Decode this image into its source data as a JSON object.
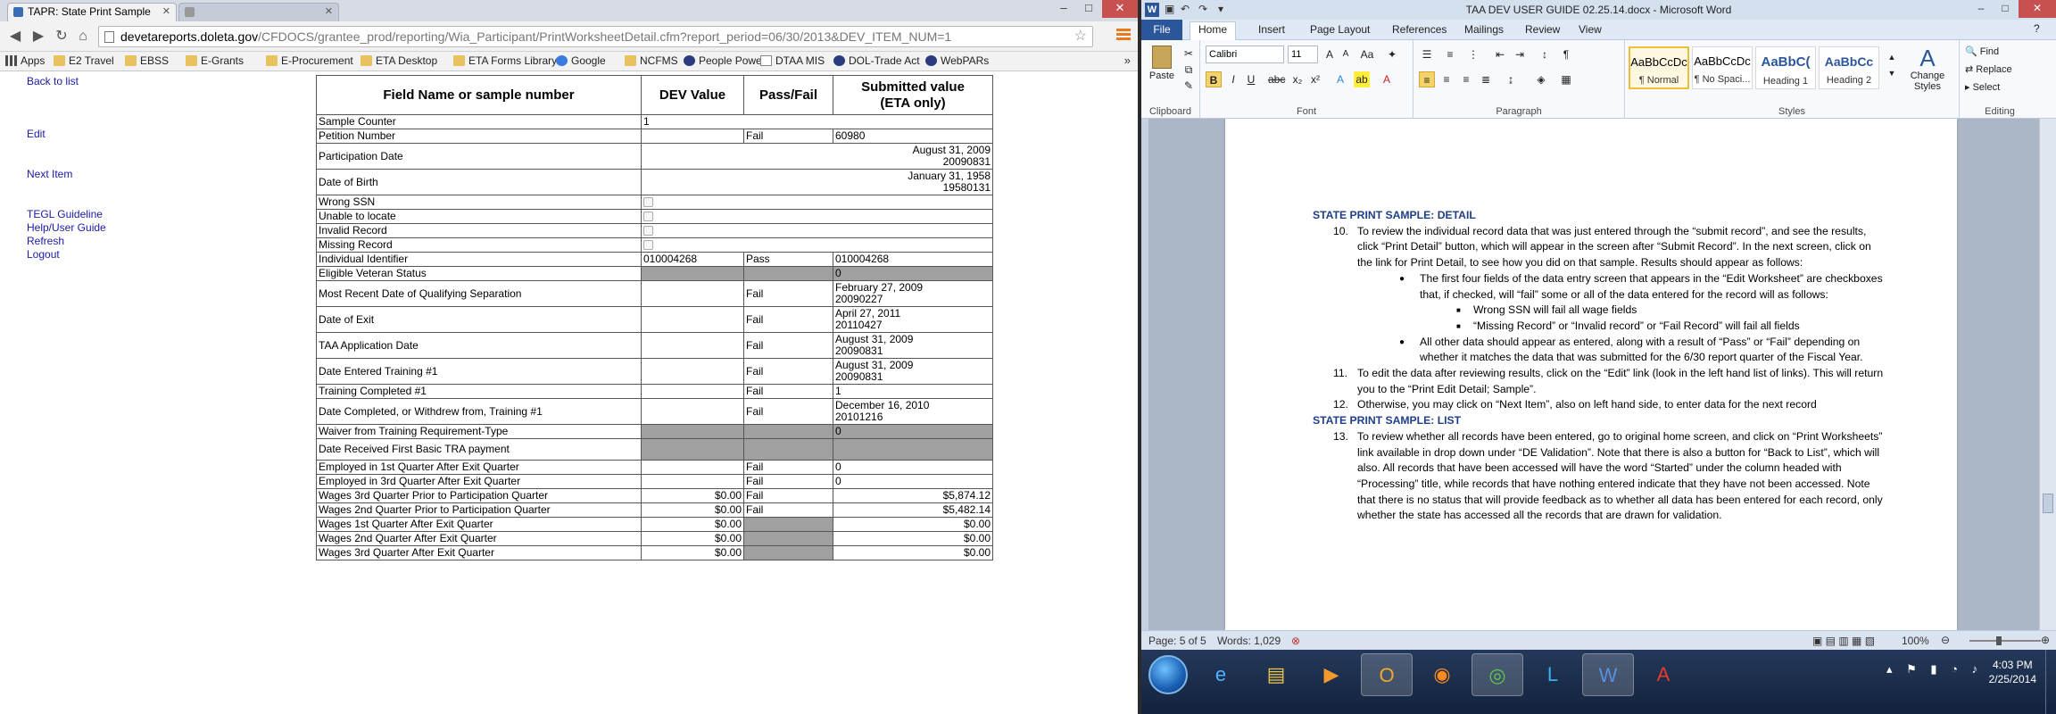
{
  "chrome": {
    "tabs": [
      {
        "title": "TAPR: State Print Sample",
        "active": true
      },
      {
        "title": "",
        "active": false
      }
    ],
    "window_controls": [
      "–",
      "□",
      "✕"
    ],
    "url_host": "devetareports.doleta.gov",
    "url_path": "/CFDOCS/grantee_prod/reporting/Wia_Participant/PrintWorksheetDetail.cfm?report_period=06/30/2013&DEV_ITEM_NUM=1",
    "bookmarks": [
      {
        "label": "Apps",
        "icon": "grid"
      },
      {
        "label": "E2 Travel",
        "icon": "folder"
      },
      {
        "label": "EBSS",
        "icon": "folder"
      },
      {
        "label": "E-Grants",
        "icon": "folder"
      },
      {
        "label": "E-Procurement",
        "icon": "folder"
      },
      {
        "label": "ETA Desktop",
        "icon": "folder"
      },
      {
        "label": "ETA Forms Library",
        "icon": "folder"
      },
      {
        "label": "Google",
        "icon": "g"
      },
      {
        "label": "NCFMS",
        "icon": "folder"
      },
      {
        "label": "People Power",
        "icon": "round"
      },
      {
        "label": "DTAA MIS",
        "icon": "page"
      },
      {
        "label": "DOL-Trade Act",
        "icon": "round"
      },
      {
        "label": "WebPARs",
        "icon": "round"
      }
    ],
    "bookmarks_more": "»"
  },
  "page": {
    "side_links": {
      "back": "Back to list",
      "edit": "Edit",
      "next": "Next Item",
      "tegl": "TEGL Guideline",
      "help": "Help/User Guide",
      "refresh": "Refresh",
      "logout": "Logout"
    },
    "headers": [
      "Field Name or sample number",
      "DEV Value",
      "Pass/Fail",
      "Submitted value\n(ETA only)"
    ],
    "rows": [
      {
        "field": "Sample Counter",
        "span": "1",
        "merged": true
      },
      {
        "field": "Petition Number",
        "dev": "",
        "pf": "Fail",
        "sub": "60980"
      },
      {
        "field": "Participation Date",
        "merged_right": "August 31, 2009\n20090831",
        "tall": true
      },
      {
        "field": "Date of Birth",
        "merged_right": "January 31, 1958\n19580131",
        "tall": true
      },
      {
        "field": "Wrong SSN",
        "checkbox": true
      },
      {
        "field": "Unable to locate",
        "checkbox": true
      },
      {
        "field": "Invalid Record",
        "checkbox": true
      },
      {
        "field": "Missing Record",
        "checkbox": true
      },
      {
        "field": "Individual Identifier",
        "dev": "010004268",
        "pf": "Pass",
        "sub": "010004268"
      },
      {
        "field": "Eligible Veteran Status",
        "shade": true,
        "sub": "0"
      },
      {
        "field": "Most Recent Date of Qualifying Separation",
        "dev": "",
        "pf": "Fail",
        "sub": "February 27, 2009\n20090227",
        "tall": true
      },
      {
        "field": "Date of Exit",
        "dev": "",
        "pf": "Fail",
        "sub": "April 27, 2011\n20110427",
        "tall": true
      },
      {
        "field": "TAA Application Date",
        "dev": "",
        "pf": "Fail",
        "sub": "August 31, 2009\n20090831",
        "tall": true
      },
      {
        "field": "Date Entered Training #1",
        "dev": "",
        "pf": "Fail",
        "sub": "August 31, 2009\n20090831",
        "tall": true
      },
      {
        "field": "Training Completed #1",
        "dev": "",
        "pf": "Fail",
        "sub": "1"
      },
      {
        "field": "Date Completed, or Withdrew from, Training #1",
        "dev": "",
        "pf": "Fail",
        "sub": "December 16, 2010\n20101216",
        "tall": true
      },
      {
        "field": "Waiver from Training Requirement-Type",
        "shade": true,
        "sub": "0"
      },
      {
        "field": "Date Received First Basic TRA payment",
        "shade": true,
        "sub": "",
        "tall": true
      },
      {
        "field": "Employed in 1st Quarter After Exit Quarter",
        "dev": "",
        "pf": "Fail",
        "sub": "0"
      },
      {
        "field": "Employed in 3rd Quarter After Exit Quarter",
        "dev": "",
        "pf": "Fail",
        "sub": "0"
      },
      {
        "field": "Wages 3rd Quarter Prior to Participation Quarter",
        "dev": "$0.00",
        "pf": "Fail",
        "sub": "$5,874.12",
        "money": true
      },
      {
        "field": "Wages 2nd Quarter Prior to Participation Quarter",
        "dev": "$0.00",
        "pf": "Fail",
        "sub": "$5,482.14",
        "money": true
      },
      {
        "field": "Wages 1st Quarter After Exit Quarter",
        "dev": "$0.00",
        "pf": "",
        "sub": "$0.00",
        "money": true,
        "shade_pf": true
      },
      {
        "field": "Wages 2nd Quarter After Exit Quarter",
        "dev": "$0.00",
        "pf": "",
        "sub": "$0.00",
        "money": true,
        "shade_pf": true
      },
      {
        "field": "Wages 3rd Quarter After Exit Quarter",
        "dev": "$0.00",
        "pf": "",
        "sub": "$0.00",
        "money": true,
        "shade_pf": true
      }
    ]
  },
  "word": {
    "icon": "W",
    "title": "TAA DEV USER GUIDE 02.25.14.docx - Microsoft Word",
    "tabs": [
      "File",
      "Home",
      "Insert",
      "Page Layout",
      "References",
      "Mailings",
      "Review",
      "View"
    ],
    "font_name": "Calibri",
    "font_size": "11",
    "groups": {
      "clipboard": "Clipboard",
      "font": "Font",
      "paragraph": "Paragraph",
      "styles": "Styles",
      "editing": "Editing"
    },
    "paste": "Paste",
    "styles": [
      {
        "preview": "AaBbCcDc",
        "label": "¶ Normal"
      },
      {
        "preview": "AaBbCcDc",
        "label": "¶ No Spaci..."
      },
      {
        "preview": "AaBbC(",
        "label": "Heading 1"
      },
      {
        "preview": "AaBbCc",
        "label": "Heading 2"
      }
    ],
    "change_styles": "Change\nStyles",
    "editing": [
      "Find",
      "Replace",
      "Select"
    ],
    "doc": {
      "h1": "STATE PRINT SAMPLE: DETAIL",
      "i10_num": "10.",
      "i10": "To review the individual record data that was just entered through the “submit record”, and see the results, click “Print Detail” button, which will appear in the screen after “Submit Record”. In the next screen, click on the link for Print Detail, to see how you did on that sample.  Results should appear as follows:",
      "b1": "The first four fields of the data entry screen that appears in the “Edit Worksheet” are checkboxes that, if checked, will “fail” some or all of the data entered for the record will  as follows:",
      "s1": "Wrong SSN will fail all wage fields",
      "s2": "“Missing Record” or “Invalid record” or “Fail Record” will fail all fields",
      "b2": "All other data should appear as entered, along with a result of “Pass” or “Fail” depending on whether it matches the data that was submitted for the 6/30 report quarter of the Fiscal Year.",
      "i11_num": "11.",
      "i11": "To edit the data after reviewing results, click on the “Edit” link (look in the left hand list of links).  This will return you to the “Print Edit Detail; Sample”.",
      "i12_num": "12.",
      "i12": "Otherwise, you may click on “Next Item”, also on left hand side, to enter data for the next record",
      "h2": "STATE PRINT SAMPLE: LIST",
      "i13_num": "13.",
      "i13": "To review whether all records have been entered, go to original home screen, and click on “Print Worksheets” link available in drop down under “DE Validation”. Note that there is also a button for “Back to List”, which will also.  All records that have been accessed will have the word “Started” under the column headed with “Processing” title, while records that have nothing entered indicate that they have not been accessed. Note that there is no status that will provide feedback as to whether all data has been entered for each record, only whether the state has accessed all the records that are drawn for validation."
    },
    "status": {
      "page": "Page: 5 of 5",
      "words": "Words: 1,029",
      "zoom": "100%"
    }
  },
  "taskbar": {
    "apps": [
      "start",
      "ie",
      "explorer",
      "media",
      "outlook",
      "firefox",
      "chrome",
      "lync",
      "word",
      "acrobat"
    ],
    "time": "4:03 PM",
    "date": "2/25/2014"
  }
}
